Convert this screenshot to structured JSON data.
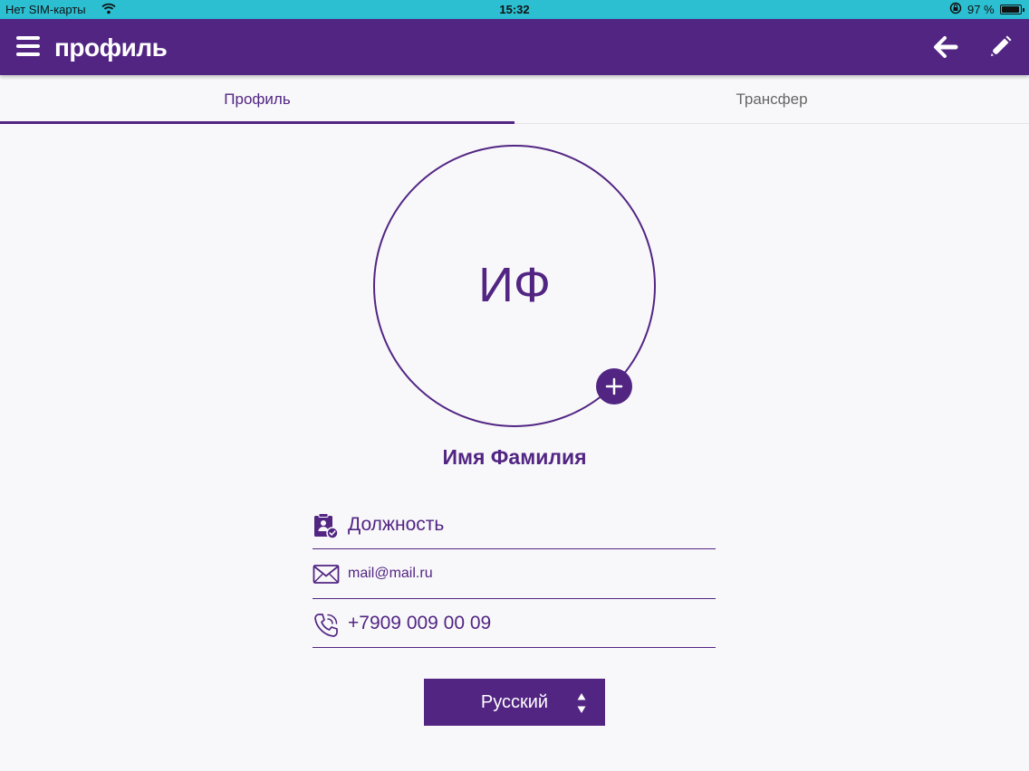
{
  "status_bar": {
    "carrier": "Нет SIM-карты",
    "time": "15:32",
    "battery_percent": "97 %",
    "battery_level": 0.97
  },
  "header": {
    "title": "профиль",
    "icons": [
      "menu-icon",
      "arrow-left-icon",
      "pencil-icon"
    ]
  },
  "tabs": [
    {
      "label": "Профиль",
      "active": true
    },
    {
      "label": "Трансфер",
      "active": false
    }
  ],
  "profile": {
    "initials": "ИФ",
    "name": "Имя Фамилия",
    "position": "Должность",
    "email": "mail@mail.ru",
    "phone": "+7909 009 00 09"
  },
  "language": {
    "selected": "Русский"
  },
  "colors": {
    "primary": "#522583",
    "status_bar": "#2cbfd2",
    "background": "#f8f8fa"
  }
}
